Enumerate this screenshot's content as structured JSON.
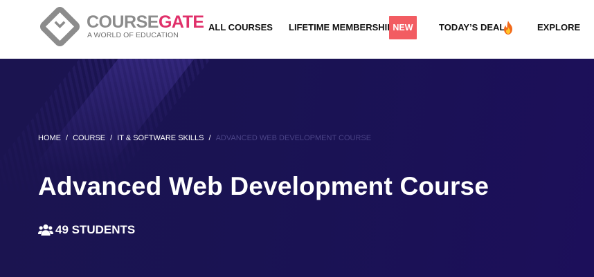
{
  "header": {
    "logo": {
      "word_course": "COURSE",
      "word_gate": "GATE",
      "tagline": "A WORLD OF EDUCATION",
      "mark_icon": "diamond-logo-icon"
    },
    "nav": {
      "all_courses": "ALL COURSES",
      "lifetime_membership": "LIFETIME MEMBERSHIP",
      "new_badge": "NEW",
      "todays_deal": "TODAY’S DEAL",
      "deal_icon": "fire-icon",
      "explore": "EXPLORE"
    }
  },
  "hero": {
    "breadcrumb": {
      "home": "HOME",
      "course": "COURSE",
      "category": "IT & SOFTWARE SKILLS",
      "current": "ADVANCED WEB DEVELOPMENT COURSE",
      "separator": "/"
    },
    "title": "Advanced Web Development Course",
    "students": {
      "icon": "users-icon",
      "label": "49 STUDENTS"
    }
  },
  "colors": {
    "brand_gray": "#8c8c8c",
    "brand_pink": "#e0306a",
    "badge_red": "#f25c62",
    "hero_bg": "#1b1450",
    "breadcrumb_current": "#4a4386"
  }
}
